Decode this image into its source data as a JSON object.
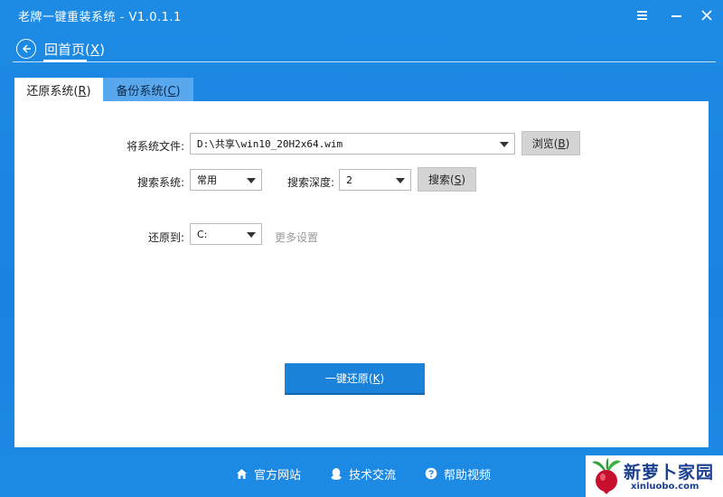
{
  "window": {
    "title": "老牌一键重装系统 - V1.0.1.1"
  },
  "nav": {
    "back_label": "回首页",
    "back_hotkey": "X"
  },
  "tabs": [
    {
      "label": "还原系统",
      "hotkey": "R",
      "active": true
    },
    {
      "label": "备份系统",
      "hotkey": "C",
      "active": false
    }
  ],
  "form": {
    "file_label": "将系统文件:",
    "file_value": "D:\\共享\\win10_20H2x64.wim",
    "browse": {
      "label": "浏览",
      "hotkey": "B"
    },
    "search_system_label": "搜索系统:",
    "search_system_value": "常用",
    "search_depth_label": "搜索深度:",
    "search_depth_value": "2",
    "search": {
      "label": "搜索",
      "hotkey": "S"
    },
    "restore_to_label": "还原到:",
    "restore_to_value": "C:",
    "more_settings": "更多设置",
    "restore": {
      "label": "一键还原",
      "hotkey": "K"
    }
  },
  "footer": [
    {
      "label": "官方网站",
      "icon": "home-icon"
    },
    {
      "label": "技术交流",
      "icon": "qq-icon"
    },
    {
      "label": "帮助视频",
      "icon": "help-icon"
    }
  ],
  "watermark": {
    "title": "新萝卜家园",
    "url": "xinluobo.com"
  },
  "colors": {
    "accent": "#1a86e0",
    "primary_button": "#1a82d8",
    "tab_inactive": "#59a8ee",
    "panel": "#ffffff"
  }
}
